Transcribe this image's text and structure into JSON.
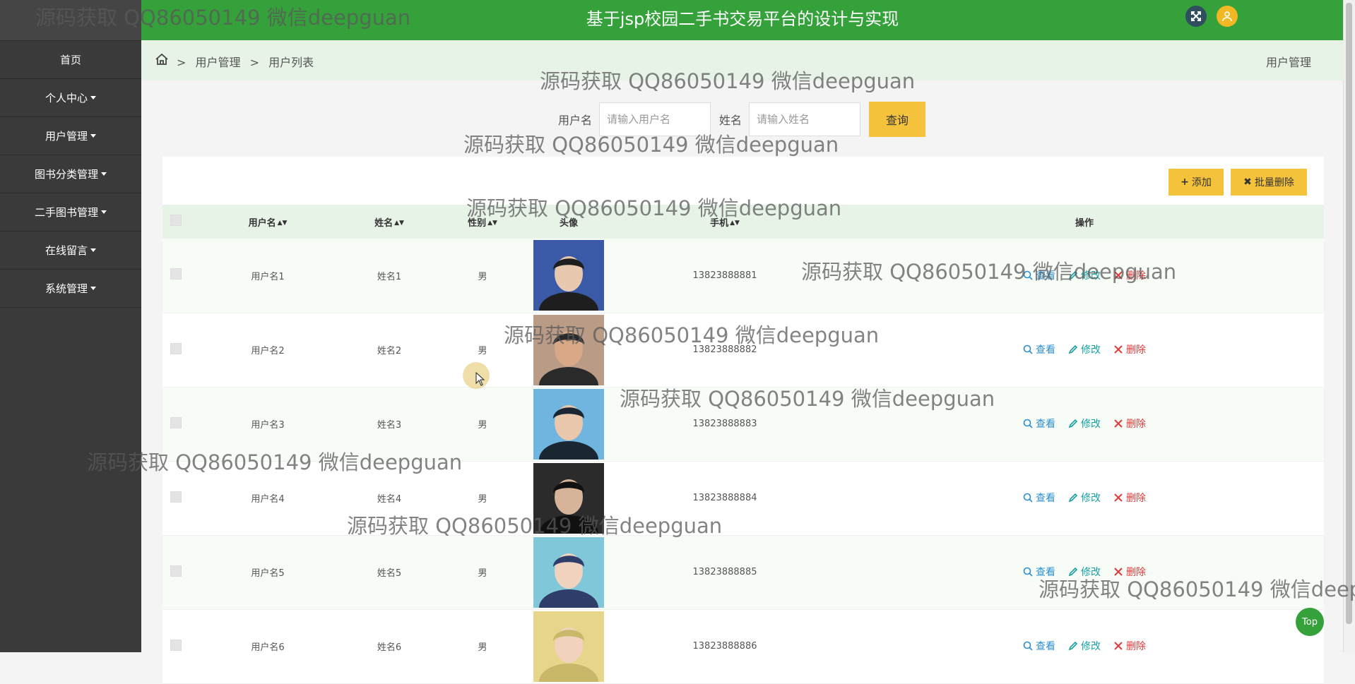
{
  "header": {
    "title": "基于jsp校园二手书交易平台的设计与实现"
  },
  "sidebar": {
    "items": [
      {
        "label": "首页",
        "dropdown": false
      },
      {
        "label": "个人中心",
        "dropdown": true
      },
      {
        "label": "用户管理",
        "dropdown": true
      },
      {
        "label": "图书分类管理",
        "dropdown": true
      },
      {
        "label": "二手图书管理",
        "dropdown": true
      },
      {
        "label": "在线留言",
        "dropdown": true
      },
      {
        "label": "系统管理",
        "dropdown": true
      }
    ]
  },
  "breadcrumb": {
    "sep": ">",
    "level1": "用户管理",
    "level2": "用户列表",
    "right": "用户管理"
  },
  "search": {
    "username_label": "用户名",
    "username_placeholder": "请输入用户名",
    "name_label": "姓名",
    "name_placeholder": "请输入姓名",
    "query_label": "查询"
  },
  "toolbar": {
    "add_label": "添加",
    "batch_delete_label": "批量删除"
  },
  "table": {
    "headers": {
      "username": "用户名",
      "name": "姓名",
      "gender": "性别",
      "avatar": "头像",
      "phone": "手机",
      "ops": "操作"
    },
    "actions": {
      "view": "查看",
      "edit": "修改",
      "delete": "删除"
    },
    "rows": [
      {
        "username": "用户名1",
        "name": "姓名1",
        "gender": "男",
        "phone": "13823888881"
      },
      {
        "username": "用户名2",
        "name": "姓名2",
        "gender": "男",
        "phone": "13823888882"
      },
      {
        "username": "用户名3",
        "name": "姓名3",
        "gender": "男",
        "phone": "13823888883"
      },
      {
        "username": "用户名4",
        "name": "姓名4",
        "gender": "男",
        "phone": "13823888884"
      },
      {
        "username": "用户名5",
        "name": "姓名5",
        "gender": "男",
        "phone": "13823888885"
      },
      {
        "username": "用户名6",
        "name": "姓名6",
        "gender": "男",
        "phone": "13823888886"
      }
    ]
  },
  "watermark": "源码获取 QQ86050149 微信deepguan",
  "top_button": "Top",
  "colors": {
    "header": "#35a13a",
    "sidebar": "#3a3a3a",
    "accent_button": "#f5c33b",
    "breadcrumb_bg": "#e8f3e8"
  }
}
